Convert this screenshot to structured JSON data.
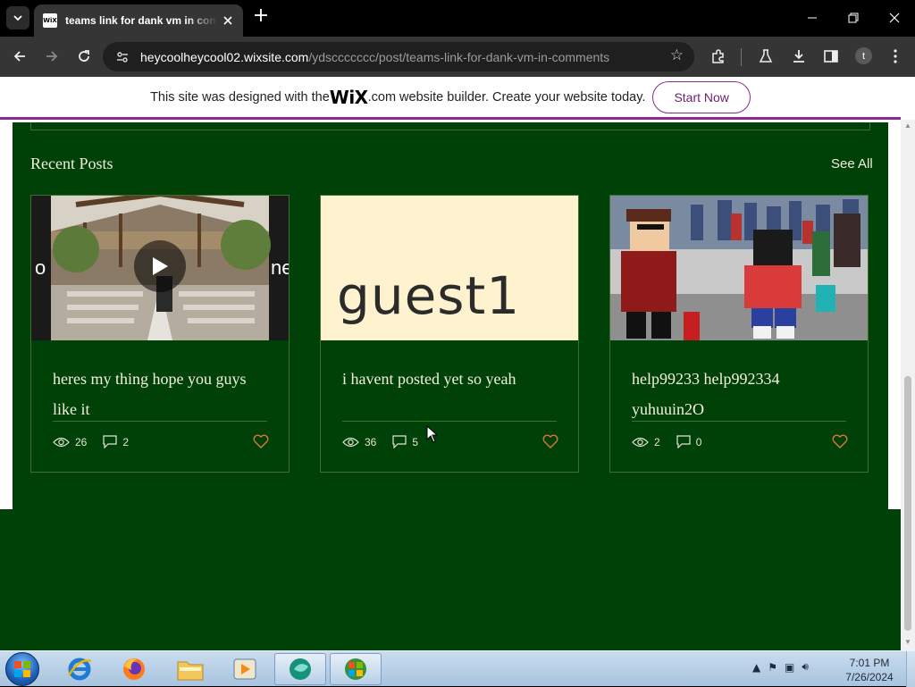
{
  "browser": {
    "tab": {
      "favicon_text": "WiX",
      "title": "teams link for dank vm in comments"
    },
    "address": {
      "host": "heycoolheycool02.wixsite.com",
      "path": "/ydsccccccc/post/teams-link-for-dank-vm-in-comments"
    },
    "profile_initial": "t"
  },
  "wix_banner": {
    "text_before": "This site was designed with the ",
    "logo": "WiX",
    "text_after": ".com website builder. Create your website today.",
    "cta": "Start Now"
  },
  "recent_posts": {
    "heading": "Recent Posts",
    "see_all": "See All",
    "posts": [
      {
        "title": "heres my thing hope you guys like it",
        "views": "26",
        "comments": "2",
        "thumb": "video-wedding"
      },
      {
        "title": "i havent posted yet so yeah",
        "views": "36",
        "comments": "5",
        "thumb_text": "guest1"
      },
      {
        "title": "help99233 help992334 yuhuuin2O",
        "views": "2",
        "comments": "0",
        "thumb": "roblox-crowd"
      }
    ]
  },
  "colors": {
    "site_green": "#004107",
    "wix_purple": "#8a2b91",
    "heart_orange": "#d9773a"
  },
  "taskbar": {
    "time": "7:01 PM",
    "date": "7/26/2024"
  }
}
